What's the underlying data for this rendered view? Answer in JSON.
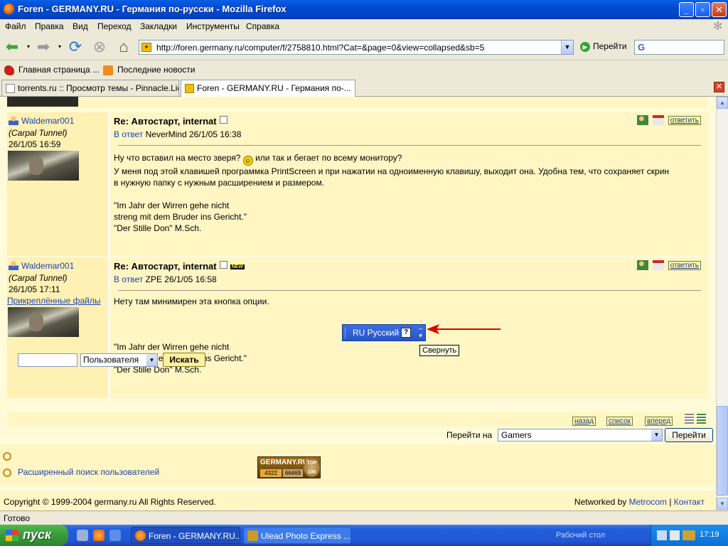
{
  "window": {
    "title": "Foren - GERMANY.RU - Германия по-русски - Mozilla Firefox",
    "min": "_",
    "max": "▫",
    "close": "✕"
  },
  "menu": [
    "Файл",
    "Правка",
    "Вид",
    "Переход",
    "Закладки",
    "Инструменты",
    "Справка"
  ],
  "nav": {
    "url": "http://foren.germany.ru/computer/f/2758810.html?Cat=&page=0&view=collapsed&sb=5",
    "go_label": "Перейти",
    "search_glyph": "G"
  },
  "bookmarks": [
    {
      "label": "Главная страница ..."
    },
    {
      "label": "Последние новости"
    }
  ],
  "tabs": [
    {
      "label": "torrents.ru :: Просмотр темы - Pinnacle.Liq...",
      "active": false
    },
    {
      "label": "Foren - GERMANY.RU - Германия по-...",
      "active": true
    }
  ],
  "posts": [
    {
      "author": "Waldemar001",
      "author_title": "(Carpal Tunnel)",
      "date": "26/1/05 16:59",
      "attachments": "",
      "subject": "Re: Автостарт, internat",
      "is_new": false,
      "reply_prefix": "В ответ",
      "reply_to": "NeverMind 26/1/05 16:38",
      "reply_label": "ответить",
      "body": [
        "Ну что вставил на место зверя?",
        "или так и бегает по всему монитору?",
        "У меня под этой клавишей программка PrintScreen и при нажатии на одноименную клавишу, выходит она. Удобна тем, что сохраняет скрин",
        "в нужную папку с нужным расширением и размером."
      ],
      "signature": [
        "\"Im Jahr der Wirren gehe nicht",
        "streng mit dem Bruder ins Gericht.\"",
        "\"Der Stille Don\" M.Sch."
      ]
    },
    {
      "author": "Waldemar001",
      "author_title": "(Carpal Tunnel)",
      "date": "26/1/05 17:11",
      "attachments": "Прикреплённые файлы",
      "subject": "Re: Автостарт, internat",
      "is_new": true,
      "new_badge": "NEW",
      "reply_prefix": "В ответ",
      "reply_to": "ZPE 26/1/05 16:58",
      "reply_label": "ответить",
      "body": [
        "Нету там минимирен эта кнопка опции."
      ],
      "signature": [
        "\"Im Jahr der Wirren gehe nicht",
        "streng mit dem Bruder ins Gericht.\"",
        "\"Der Stille Don\" M.Sch."
      ]
    }
  ],
  "langbar": {
    "label": "RU Русский",
    "help": "?",
    "tooltip": "Свернуть"
  },
  "bottom_nav": {
    "back": "назад",
    "list": "список",
    "forward": "вперед"
  },
  "jump": {
    "label": "Перейти на",
    "selected": "Gamers",
    "button": "Перейти"
  },
  "user_search": {
    "input_value": "",
    "type_selected": "Пользователя",
    "button": "Искать",
    "advanced": "Расширенный поиск пользователей"
  },
  "badge": {
    "name": "GERMANY.RU",
    "n1": "4322",
    "n2": "66469",
    "top": "TOP 100"
  },
  "footer": {
    "copyright": "Copyright © 1999-2004 germany.ru All Rights Reserved.",
    "networked_by": "Networked by",
    "metrocom": "Metrocom",
    "sep": "|",
    "contact": "Контакт"
  },
  "status": "Готово",
  "taskbar": {
    "start": "пуск",
    "tasks": [
      {
        "label": "Foren - GERMANY.RU..."
      },
      {
        "label": "Ulead Photo Express ..."
      }
    ],
    "desktop": "Рабочий стол",
    "clock": "17:19"
  },
  "colors": {
    "titlebar": "#0049cf",
    "content_bg": "#fffbd9",
    "link": "#1c46b0",
    "arrow": "#e00000"
  }
}
